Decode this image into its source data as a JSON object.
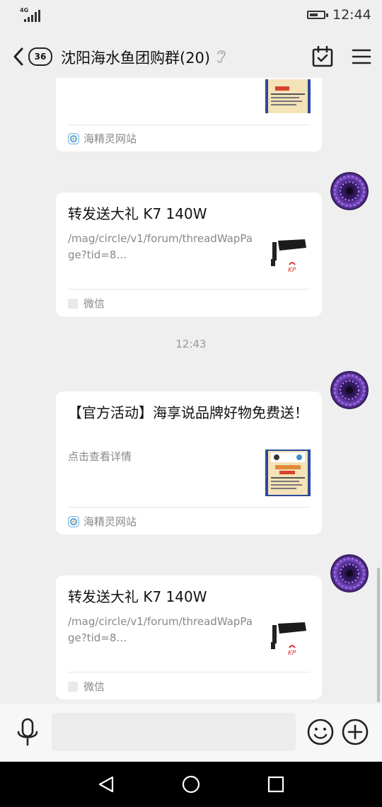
{
  "status_bar": {
    "network": "4G",
    "battery_level": 0.6,
    "time": "12:44"
  },
  "nav": {
    "unread_count": "36",
    "title": "沈阳海水鱼团购群(20)",
    "icons": [
      "chevron-left-icon",
      "ear-icon",
      "calendar-check-icon",
      "menu-icon"
    ]
  },
  "messages": {
    "card0": {
      "source": "海精灵网站"
    },
    "card1": {
      "title": "转发送大礼 K7 140W",
      "desc": "/mag/circle/v1/forum/threadWapPage?tid=8…",
      "source": "微信"
    },
    "time_separator": "12:43",
    "card2": {
      "title": "【官方活动】海享说品牌好物免费送！",
      "desc": "点击查看详情",
      "source": "海精灵网站"
    },
    "card3": {
      "title": "转发送大礼 K7 140W",
      "desc": "/mag/circle/v1/forum/threadWapPage?tid=8…",
      "source": "微信"
    }
  },
  "input_bar": {
    "placeholder": "",
    "icons": [
      "microphone-icon",
      "emoji-icon",
      "plus-icon"
    ]
  },
  "colors": {
    "chat_background": "#efefef",
    "card_background": "#ffffff",
    "secondary_text": "#888888",
    "avatar_purple": "#5b2c8f"
  }
}
